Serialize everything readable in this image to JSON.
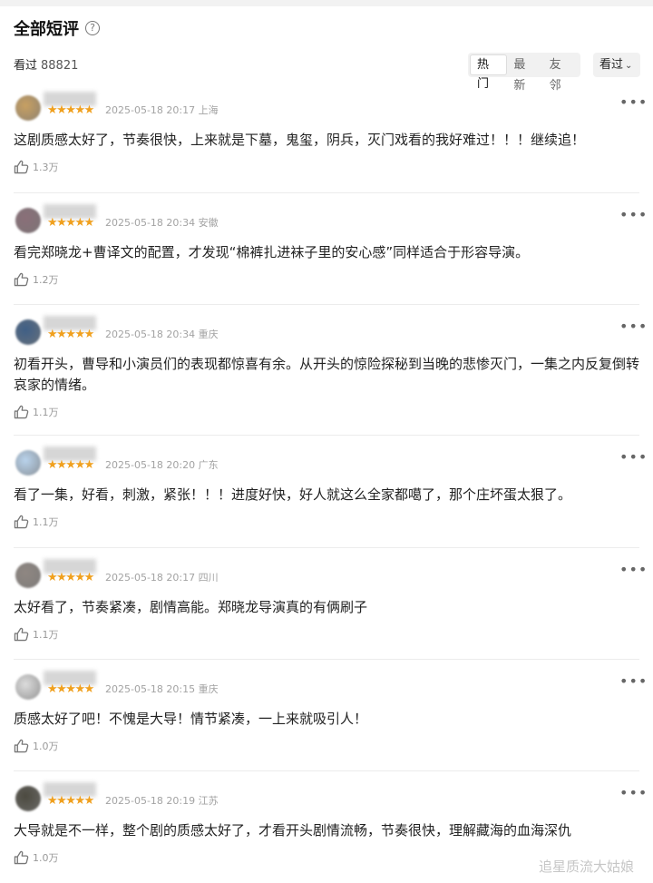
{
  "header": {
    "title": "全部短评",
    "help_icon": "help-icon",
    "seen_label": "看过",
    "seen_count": "88821"
  },
  "sort_tabs": [
    {
      "label": "热门",
      "active": true
    },
    {
      "label": "最新",
      "active": false
    },
    {
      "label": "友邻",
      "active": false
    }
  ],
  "filter": {
    "label": "看过",
    "icon": "chevron-down-icon"
  },
  "comments": [
    {
      "avatar_color": "#c8a062",
      "stars": "★★★★★",
      "time": "2025-05-18 20:17",
      "location": "上海",
      "text": "这剧质感太好了，节奏很快，上来就是下墓，鬼玺，阴兵，灭门戏看的我好难过！！！继续追！",
      "likes": "1.3万"
    },
    {
      "avatar_color": "#8a6f78",
      "stars": "★★★★★",
      "time": "2025-05-18 20:34",
      "location": "安徽",
      "text": "看完郑晓龙+曹译文的配置，才发现“棉裤扎进袜子里的安心感”同样适合于形容导演。",
      "likes": "1.2万"
    },
    {
      "avatar_color": "#3f5f86",
      "stars": "★★★★★",
      "time": "2025-05-18 20:34",
      "location": "重庆",
      "text": "初看开头，曹导和小演员们的表现都惊喜有余。从开头的惊险探秘到当晚的悲惨灭门，一集之内反复倒转哀家的情绪。",
      "likes": "1.1万"
    },
    {
      "avatar_color": "#b9d3ec",
      "stars": "★★★★★",
      "time": "2025-05-18 20:20",
      "location": "广东",
      "text": "看了一集，好看，刺激，紧张！！！进度好快，好人就这么全家都噶了，那个庄坏蛋太狠了。",
      "likes": "1.1万"
    },
    {
      "avatar_color": "#8f8782",
      "stars": "★★★★★",
      "time": "2025-05-18 20:17",
      "location": "四川",
      "text": "太好看了，节奏紧凑，剧情高能。郑晓龙导演真的有俩刷子",
      "likes": "1.1万"
    },
    {
      "avatar_color": "#dcdcdc",
      "stars": "★★★★★",
      "time": "2025-05-18 20:15",
      "location": "重庆",
      "text": "质感太好了吧！不愧是大导！情节紧凑，一上来就吸引人！",
      "likes": "1.0万"
    },
    {
      "avatar_color": "#4c4a40",
      "stars": "★★★★★",
      "time": "2025-05-18 20:19",
      "location": "江苏",
      "text": "大导就是不一样，整个剧的质感太好了，才看开头剧情流畅，节奏很快，理解藏海的血海深仇",
      "likes": "1.0万"
    }
  ],
  "watermark": "追星质流大姑娘"
}
